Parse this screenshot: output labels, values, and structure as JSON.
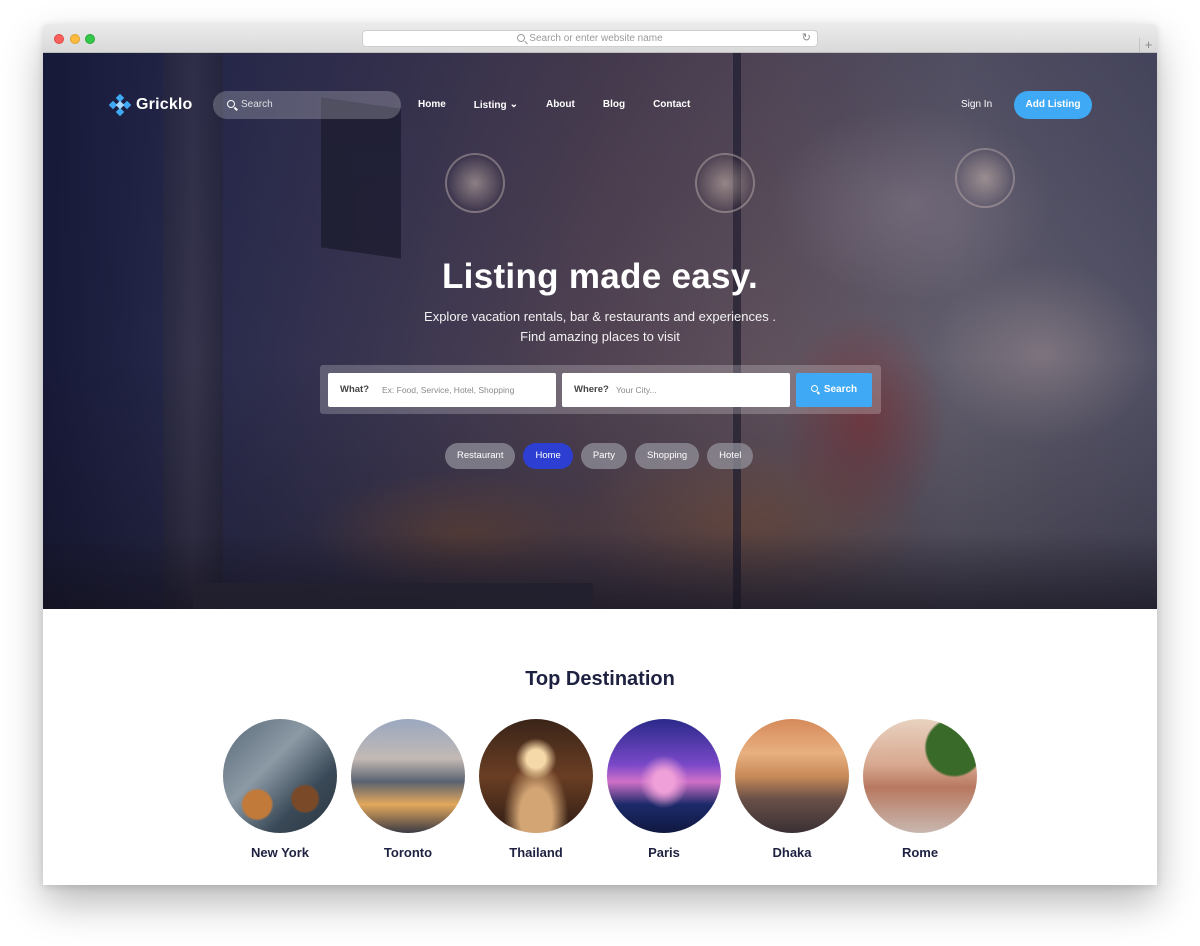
{
  "browser": {
    "url_placeholder": "Search or enter website name",
    "reload_icon": "↻",
    "newtab_icon": "+"
  },
  "header": {
    "logo_text": "Gricklo",
    "search_placeholder": "Search",
    "nav": [
      "Home",
      "Listing",
      "About",
      "Blog",
      "Contact"
    ],
    "listing_caret": "⌄",
    "sign_in": "Sign In",
    "add_listing": "Add Listing"
  },
  "hero": {
    "title": "Listing made easy.",
    "subtitle_line1": "Explore vacation rentals, bar & restaurants and experiences .",
    "subtitle_line2": "Find amazing places to visit",
    "what_label": "What?",
    "what_placeholder": "Ex: Food, Service, Hotel, Shopping",
    "where_label": "Where?",
    "where_placeholder": "Your City...",
    "search_button": "Search",
    "chips": [
      "Restaurant",
      "Home",
      "Party",
      "Shopping",
      "Hotel"
    ],
    "active_chip": "Home"
  },
  "destinations": {
    "title": "Top Destination",
    "items": [
      "New York",
      "Toronto",
      "Thailand",
      "Paris",
      "Dhaka",
      "Rome"
    ]
  },
  "colors": {
    "accent": "#3fa9f5",
    "active_chip": "#2d3fd3",
    "heading": "#1e2240"
  }
}
